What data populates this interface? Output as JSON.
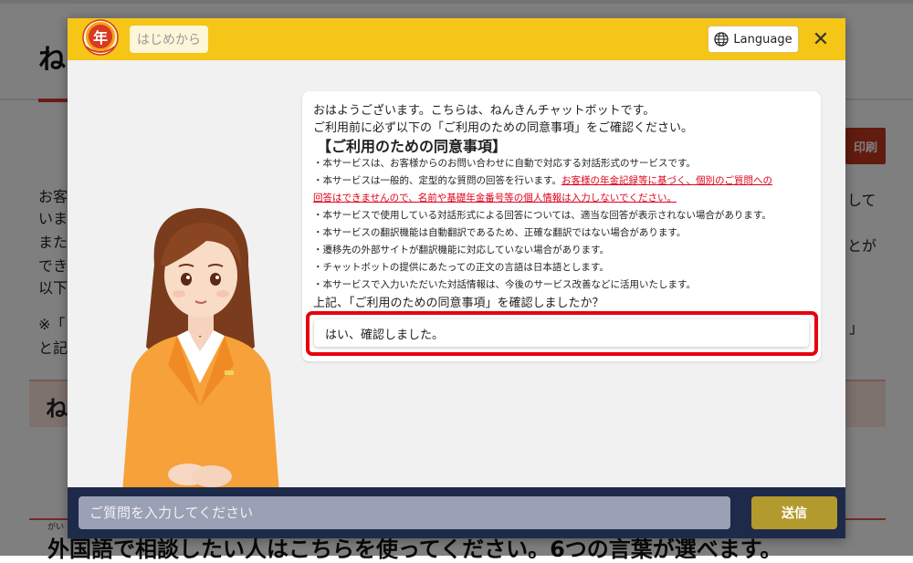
{
  "background": {
    "title": "ねんきん",
    "print_button": "印刷",
    "paragraph_lines": [
      "お客",
      "いま",
      "また",
      "でき",
      "以下"
    ],
    "right_fragments": [
      "して",
      "とが"
    ],
    "note_left": "※「",
    "note_left2": "と記",
    "note_right": "」",
    "section_title": "ね",
    "ruby": "がい",
    "bottom_text": "外国語で相談したい人はこちらを使ってください。6つの言葉が選べます。"
  },
  "header": {
    "logo_text": "年",
    "restart_label": "はじめから",
    "language_label": "Language",
    "close_label": "✕"
  },
  "message": {
    "greeting": "おはようございます。こちらは、ねんきんチャットボットです。",
    "confirm_request": "ご利用前に必ず以下の「ご利用のための同意事項」をご確認ください。",
    "heading": "【ご利用のための同意事項】",
    "item1": "・本サービスは、お客様からのお問い合わせに自動で対応する対話形式のサービスです。",
    "item2_plain": "・本サービスは一般的、定型的な質問の回答を行います。",
    "item2_red": "お客様の年金記録等に基づく、個別のご質問への",
    "item2_red_cont": "回答はできませんので、名前や基礎年金番号等の個人情報は入力しないでください。",
    "item3": "・本サービスで使用している対話形式による回答については、適当な回答が表示されない場合があります。",
    "item4": "・本サービスの翻訳機能は自動翻訳であるため、正確な翻訳ではない場合があります。",
    "item5": "・遷移先の外部サイトが翻訳機能に対応していない場合があります。",
    "item6": "・チャットボットの提供にあたっての正文の言語は日本語とします。",
    "item7": "・本サービスで入力いただいた対話情報は、今後のサービス改善などに活用いたします。",
    "question": "上記、「ご利用のための同意事項」を確認しましたか？",
    "answer_option": "はい、確認しました。"
  },
  "footer": {
    "input_placeholder": "ご質問を入力してください",
    "send_label": "送信"
  },
  "colors": {
    "header_yellow": "#f5c518",
    "footer_navy": "#1e2a4a",
    "highlight_red": "#e8000b",
    "warning_red": "#e0001a",
    "send_button": "#b39a2c"
  },
  "icons": {
    "language": "globe-icon",
    "close": "close-icon",
    "logo": "nenkin-logo-icon"
  }
}
